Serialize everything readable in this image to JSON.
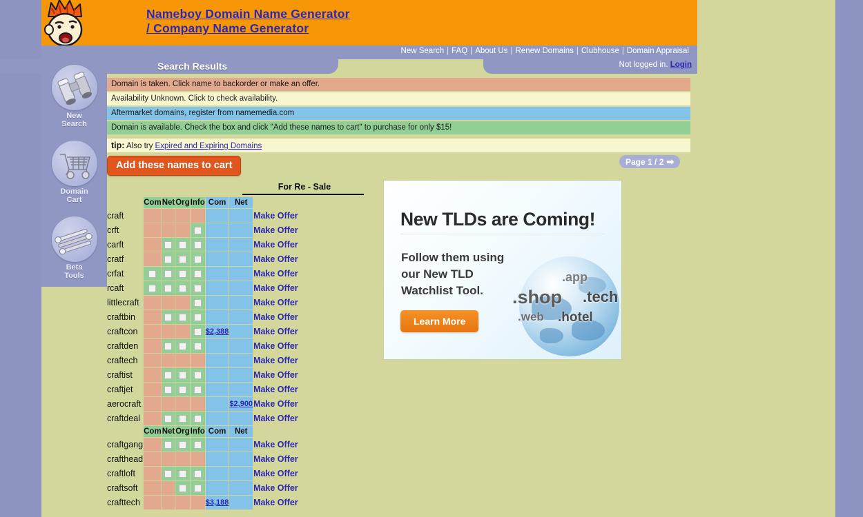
{
  "site": {
    "title_line1": "Nameboy Domain Name Generator",
    "title_line2": "/ Company Name Generator",
    "mascot_icon": "cartoon-boy-face-icon"
  },
  "nav": {
    "items": [
      {
        "label": "New Search"
      },
      {
        "label": "FAQ"
      },
      {
        "label": "About Us"
      },
      {
        "label": "Renew Domains"
      },
      {
        "label": "Clubhouse"
      },
      {
        "label": "Domain Appraisal"
      }
    ],
    "separator": "|",
    "auth_status": "Not logged in.",
    "login_label": "Login"
  },
  "results_tab": {
    "label": "Search Results"
  },
  "sidebar": {
    "items": [
      {
        "label_line1": "New",
        "label_line2": "Search",
        "icon": "binoculars-icon"
      },
      {
        "label_line1": "Domain",
        "label_line2": "Cart",
        "icon": "shopping-cart-icon"
      },
      {
        "label_line1": "Beta",
        "label_line2": "Tools",
        "icon": "wrench-tools-icon"
      }
    ]
  },
  "legend": {
    "taken": "Domain is taken. Click name to backorder or make an offer.",
    "unknown": "Availability Unknown. Click to check availability.",
    "aftermarket": "Aftermarket domains, register from namemedia.com",
    "available": "Domain is available. Check the box and click \"Add these names to cart\" to purchase for only $15!",
    "tip_prefix": "tip:",
    "tip_text": "Also try",
    "tip_link": "Expired and Expiring Domains"
  },
  "toolbar": {
    "add_to_cart_label": "Add these names to cart",
    "pager_label": "Page 1 / 2",
    "pager_arrow": "➡"
  },
  "table": {
    "resale_group_label": "For Re - Sale",
    "columns": [
      "Com",
      "Net",
      "Org",
      "Info"
    ],
    "resale_columns": [
      "Com",
      "Net"
    ],
    "offer_label": "Make Offer",
    "rows": [
      {
        "name": "craft",
        "tlds": [
          "taken",
          "taken",
          "taken",
          "taken"
        ],
        "resale": [
          "",
          ""
        ]
      },
      {
        "name": "crft",
        "tlds": [
          "taken",
          "taken",
          "taken",
          "available"
        ],
        "resale": [
          "",
          ""
        ]
      },
      {
        "name": "carft",
        "tlds": [
          "taken",
          "available",
          "available",
          "available"
        ],
        "resale": [
          "",
          ""
        ]
      },
      {
        "name": "cratf",
        "tlds": [
          "taken",
          "available",
          "available",
          "available"
        ],
        "resale": [
          "",
          ""
        ]
      },
      {
        "name": "crfat",
        "tlds": [
          "available",
          "available",
          "available",
          "available"
        ],
        "resale": [
          "",
          ""
        ]
      },
      {
        "name": "rcaft",
        "tlds": [
          "available",
          "available",
          "available",
          "available"
        ],
        "resale": [
          "",
          ""
        ]
      },
      {
        "name": "littlecraft",
        "tlds": [
          "taken",
          "taken",
          "taken",
          "available"
        ],
        "resale": [
          "",
          ""
        ]
      },
      {
        "name": "craftbin",
        "tlds": [
          "taken",
          "available",
          "available",
          "available"
        ],
        "resale": [
          "",
          ""
        ]
      },
      {
        "name": "craftcon",
        "tlds": [
          "taken",
          "taken",
          "taken",
          "available"
        ],
        "resale": [
          "$2,388",
          ""
        ]
      },
      {
        "name": "craftden",
        "tlds": [
          "taken",
          "available",
          "available",
          "available"
        ],
        "resale": [
          "",
          ""
        ]
      },
      {
        "name": "craftech",
        "tlds": [
          "taken",
          "taken",
          "taken",
          "taken"
        ],
        "resale": [
          "",
          ""
        ]
      },
      {
        "name": "craftist",
        "tlds": [
          "taken",
          "available",
          "available",
          "available"
        ],
        "resale": [
          "",
          ""
        ]
      },
      {
        "name": "craftjet",
        "tlds": [
          "taken",
          "available",
          "available",
          "available"
        ],
        "resale": [
          "",
          ""
        ]
      },
      {
        "name": "aerocraft",
        "tlds": [
          "taken",
          "taken",
          "taken",
          "taken"
        ],
        "resale": [
          "",
          "$2,900"
        ]
      },
      {
        "name": "craftdeal",
        "tlds": [
          "taken",
          "available",
          "available",
          "available"
        ],
        "resale": [
          "",
          ""
        ]
      }
    ],
    "rows2": [
      {
        "name": "craftgang",
        "tlds": [
          "taken",
          "available",
          "available",
          "available"
        ],
        "resale": [
          "",
          ""
        ]
      },
      {
        "name": "crafthead",
        "tlds": [
          "taken",
          "taken",
          "taken",
          "taken"
        ],
        "resale": [
          "",
          ""
        ]
      },
      {
        "name": "craftloft",
        "tlds": [
          "taken",
          "available",
          "available",
          "available"
        ],
        "resale": [
          "",
          ""
        ]
      },
      {
        "name": "craftsoft",
        "tlds": [
          "taken",
          "taken",
          "available",
          "available"
        ],
        "resale": [
          "",
          ""
        ]
      },
      {
        "name": "crafttech",
        "tlds": [
          "taken",
          "taken",
          "taken",
          "taken"
        ],
        "resale": [
          "$3,188",
          ""
        ]
      }
    ]
  },
  "ad": {
    "headline": "New TLDs are Coming!",
    "subtext": "Follow them using our New TLD Watchlist Tool.",
    "button_label": "Learn More",
    "tlds": {
      "shop": ".shop",
      "tech": ".tech",
      "app": ".app",
      "web": ".web",
      "hotel": ".hotel"
    }
  },
  "colors": {
    "page_bg": "#8e94c2",
    "content_bg": "#d3d79b",
    "masthead": "#f79708",
    "navbar": "#9097c3",
    "taken": "#e2a98f",
    "available": "#92cf94",
    "unknown": "#f7f6cf",
    "resale": "#83c3e8",
    "link": "#2d28b4",
    "cart_button": "#e1561d"
  }
}
